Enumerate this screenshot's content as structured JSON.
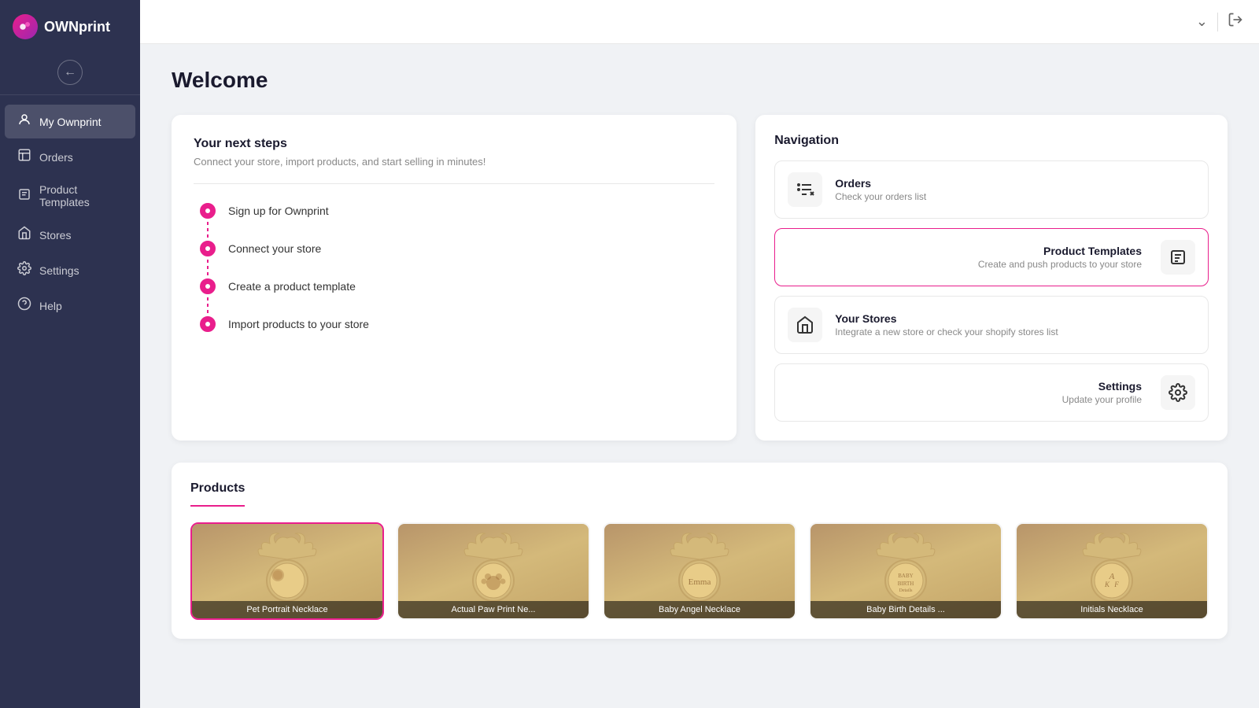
{
  "app": {
    "name": "OWNprint"
  },
  "sidebar": {
    "logo_text": "OWNprint",
    "nav_items": [
      {
        "id": "my-ownprint",
        "label": "My Ownprint",
        "icon": "👤",
        "active": true
      },
      {
        "id": "orders",
        "label": "Orders",
        "icon": "➕"
      },
      {
        "id": "product-templates",
        "label": "Product Templates",
        "icon": "📋"
      },
      {
        "id": "stores",
        "label": "Stores",
        "icon": "🏪"
      },
      {
        "id": "settings",
        "label": "Settings",
        "icon": "⚙️"
      },
      {
        "id": "help",
        "label": "Help",
        "icon": "❓"
      }
    ]
  },
  "header": {
    "title": "Welcome"
  },
  "next_steps": {
    "title": "Your next steps",
    "subtitle": "Connect your store, import products, and start selling in minutes!",
    "steps": [
      {
        "label": "Sign up for Ownprint",
        "filled": true
      },
      {
        "label": "Connect your store",
        "filled": true
      },
      {
        "label": "Create a product template",
        "filled": true
      },
      {
        "label": "Import products to your store",
        "filled": true
      }
    ]
  },
  "navigation": {
    "title": "Navigation",
    "items": [
      {
        "id": "orders",
        "label": "Orders",
        "desc": "Check your orders list",
        "icon": "≡+",
        "highlighted": false
      },
      {
        "id": "product-templates",
        "label": "Product Templates",
        "desc": "Create and push products to your store",
        "icon": "📄",
        "highlighted": true
      },
      {
        "id": "your-stores",
        "label": "Your Stores",
        "desc": "Integrate a new store or check your shopify stores list",
        "icon": "🏪",
        "highlighted": false
      },
      {
        "id": "settings",
        "label": "Settings",
        "desc": "Update your profile",
        "icon": "⚙️",
        "highlighted": false
      }
    ]
  },
  "products": {
    "section_title": "Products",
    "items": [
      {
        "name": "Pet Portrait Necklace",
        "color1": "#c8a96e",
        "color2": "#d4b983"
      },
      {
        "name": "Actual Paw Print Ne...",
        "color1": "#c9a96e",
        "color2": "#d5ba80"
      },
      {
        "name": "Baby Angel Necklace",
        "color1": "#c8a870",
        "color2": "#d4b87e"
      },
      {
        "name": "Baby Birth Details ...",
        "color1": "#c7a86e",
        "color2": "#d3b77e"
      },
      {
        "name": "Initials Necklace",
        "color1": "#c8a970",
        "color2": "#d4b97e"
      }
    ]
  }
}
